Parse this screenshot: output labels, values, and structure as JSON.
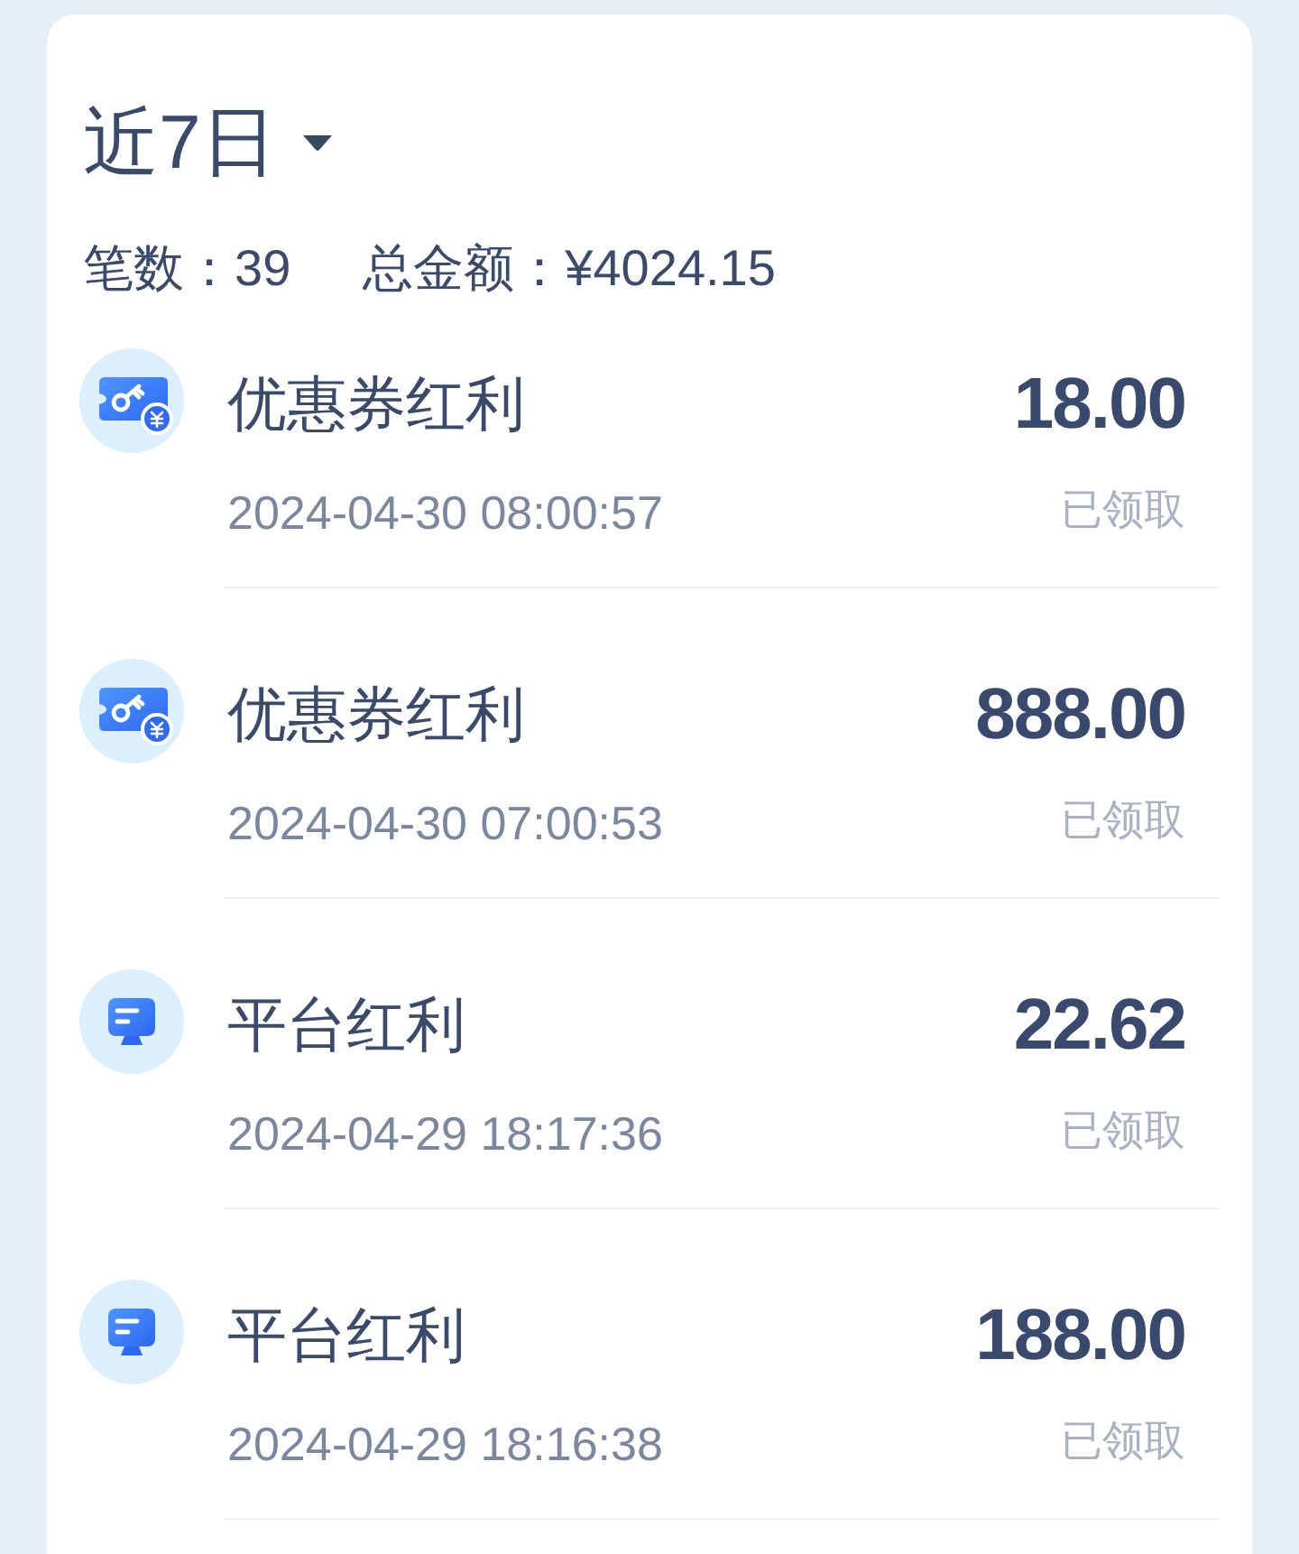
{
  "filter": {
    "label": "近7日"
  },
  "summary": {
    "count": "笔数：39",
    "total": "总金额：¥4024.15"
  },
  "records": [
    {
      "kind": "coupon",
      "title": "优惠券红利",
      "time": "2024-04-30 08:00:57",
      "amount": "18.00",
      "status": "已领取"
    },
    {
      "kind": "coupon",
      "title": "优惠券红利",
      "time": "2024-04-30 07:00:53",
      "amount": "888.00",
      "status": "已领取"
    },
    {
      "kind": "platform",
      "title": "平台红利",
      "time": "2024-04-29 18:17:36",
      "amount": "22.62",
      "status": "已领取"
    },
    {
      "kind": "platform",
      "title": "平台红利",
      "time": "2024-04-29 18:16:38",
      "amount": "188.00",
      "status": "已领取"
    }
  ]
}
